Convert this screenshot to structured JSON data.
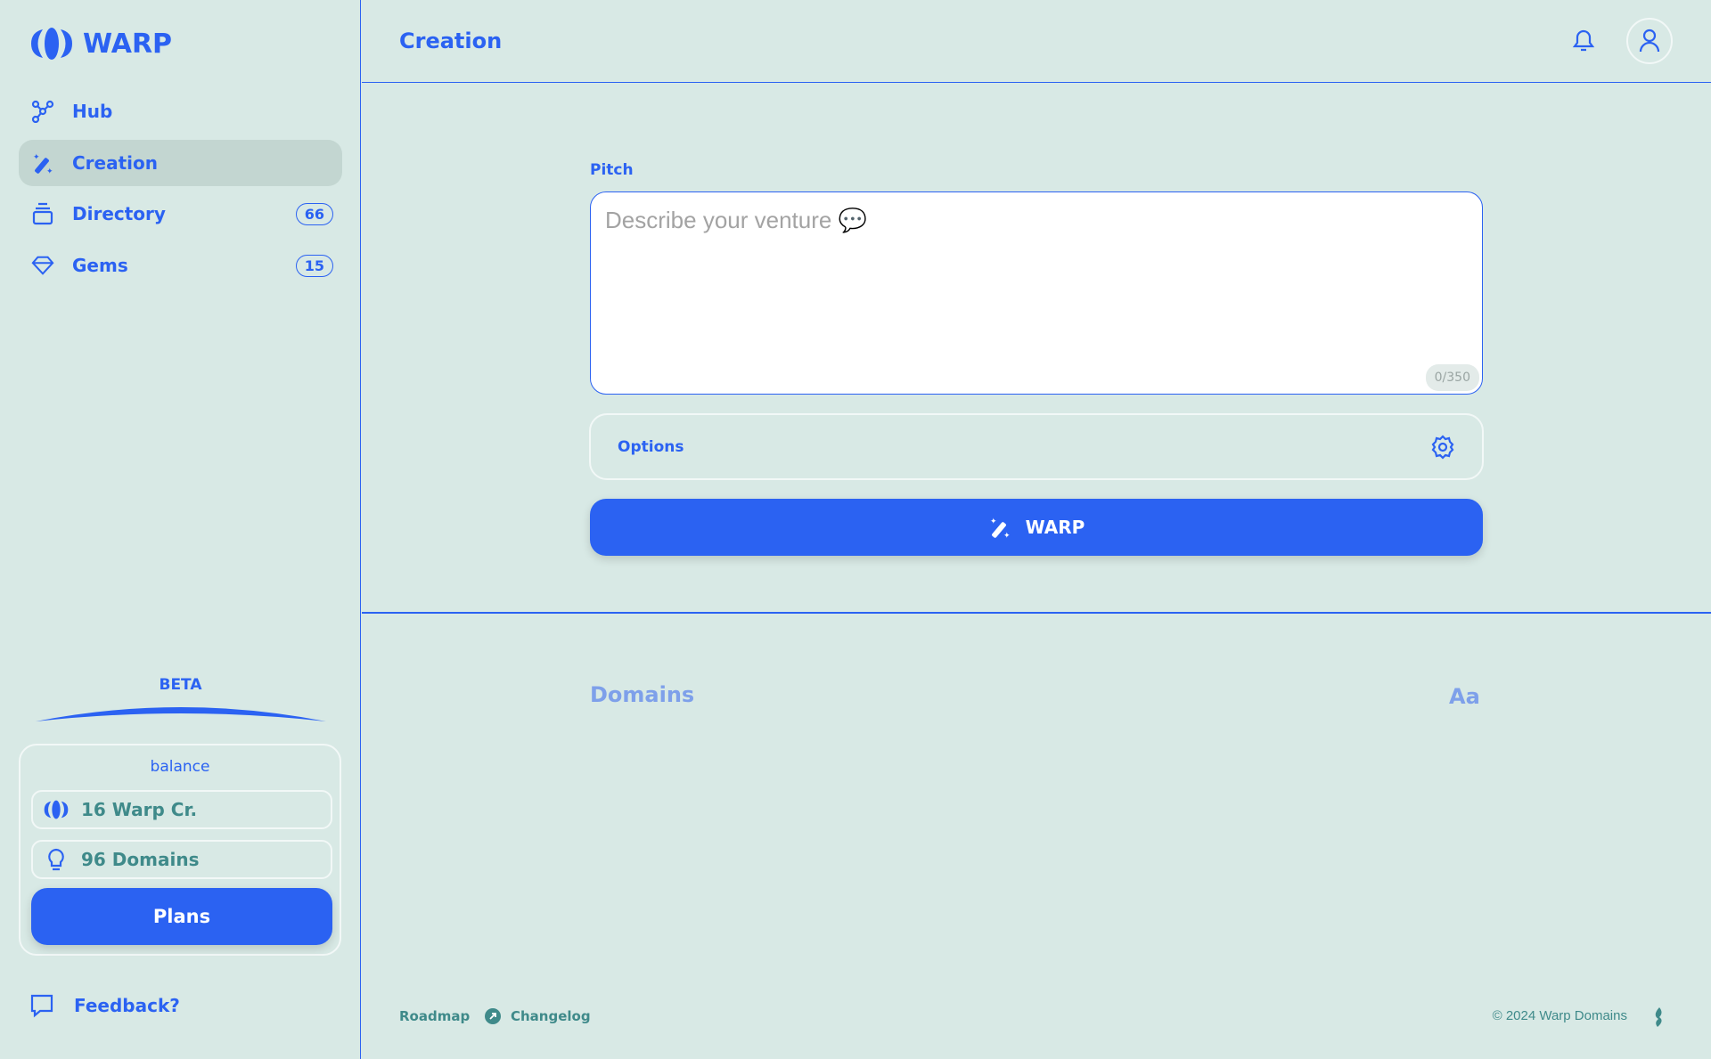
{
  "app": {
    "name": "WARP"
  },
  "sidebar": {
    "items": [
      {
        "label": "Hub",
        "icon": "hub-icon"
      },
      {
        "label": "Creation",
        "icon": "magic-wand-icon",
        "active": true
      },
      {
        "label": "Directory",
        "icon": "archive-icon",
        "count": "66"
      },
      {
        "label": "Gems",
        "icon": "gem-icon",
        "count": "15"
      }
    ],
    "beta": "BETA",
    "balance": {
      "title": "balance",
      "credits": "16 Warp Cr.",
      "domains": "96 Domains",
      "plans_label": "Plans"
    },
    "feedback": "Feedback?"
  },
  "header": {
    "title": "Creation"
  },
  "form": {
    "pitch_label": "Pitch",
    "placeholder": "Describe your venture 💬",
    "value": "",
    "counter": "0/350",
    "options_label": "Options",
    "warp_label": "WARP"
  },
  "results": {
    "title": "Domains",
    "font_toggle": "Aa"
  },
  "footer": {
    "roadmap": "Roadmap",
    "changelog": "Changelog",
    "copyright": "© 2024 Warp Domains"
  },
  "colors": {
    "accent": "#2b62f2",
    "background": "#d8e9e5",
    "muted_text": "#3f8a8a"
  }
}
